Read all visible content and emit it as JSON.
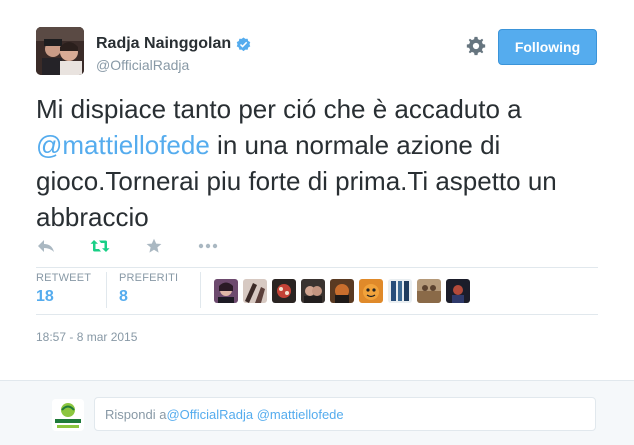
{
  "user": {
    "name": "Radja Nainggolan",
    "handle": "@OfficialRadja",
    "verified": true
  },
  "header": {
    "follow_label": "Following",
    "icons": [
      "gear-icon",
      "verified-badge-icon"
    ]
  },
  "tweet": {
    "text_before": "Mi dispiace tanto per ció che è accaduto a ",
    "mention": "@mattiellofede",
    "text_after": " in una normale azione di gioco.Tornerai piu forte di prima.Ti aspetto un abbraccio"
  },
  "actions": {
    "icons": [
      "reply-icon",
      "retweet-icon",
      "favorite-icon",
      "more-icon"
    ]
  },
  "stats": {
    "retweet_label": "RETWEET",
    "retweet_count": "18",
    "favorites_label": "PREFERITI",
    "favorites_count": "8"
  },
  "favoriters": {
    "count": 9
  },
  "meta": {
    "timestamp": "18:57 - 8 mar 2015"
  },
  "reply": {
    "prefix": "Rispondi a ",
    "mention1": "@OfficialRadja",
    "mention2": "@mattiellofede"
  },
  "colors": {
    "accent": "#55acee",
    "muted": "#8899a6",
    "text": "#292f33",
    "retweet_green": "#19cf86",
    "reply_bg": "#f5f8fa"
  }
}
